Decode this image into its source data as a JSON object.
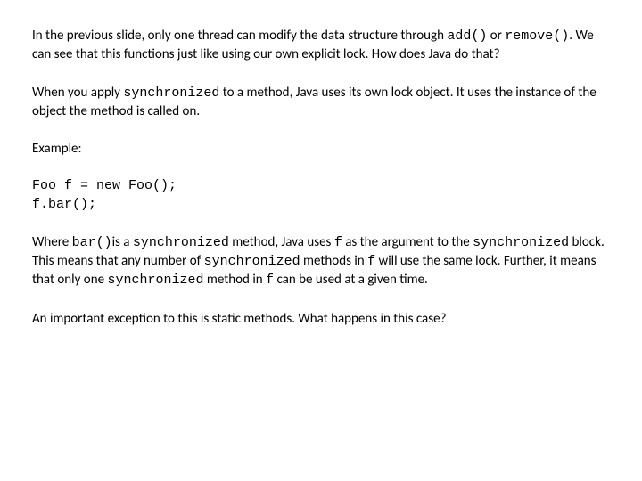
{
  "slide": {
    "p1": {
      "t1": "In the previous slide, only one thread can modify the data structure through ",
      "c1": "add()",
      "t2": " or ",
      "c2": "remove()",
      "t3": ".  We can see that this functions just like using our own explicit lock.  How does Java do that?"
    },
    "p2": {
      "t1": "When you apply ",
      "c1": "synchronized",
      "t2": " to a method, Java uses its own lock object.  It uses the instance of the object the method is called on."
    },
    "example_label": "Example:",
    "code": {
      "line1": "Foo f = new Foo();",
      "line2": "f.bar();"
    },
    "p3": {
      "t1": "Where ",
      "c1": "bar()",
      "t2": "is a ",
      "c2": "synchronized",
      "t3": " method, Java uses ",
      "c3": "f",
      "t4": " as the argument to the ",
      "c4": "synchronized",
      "t5": " block.  This means that any number of ",
      "c5": "synchronized",
      "t6": " methods in ",
      "c6": "f",
      "t7": " will use the same lock.  Further, it means that only one ",
      "c7": "synchronized",
      "t8": " method in ",
      "c8": "f",
      "t9": " can be used at a given time."
    },
    "p4": "An important exception to this is static methods.  What happens in this case?"
  }
}
